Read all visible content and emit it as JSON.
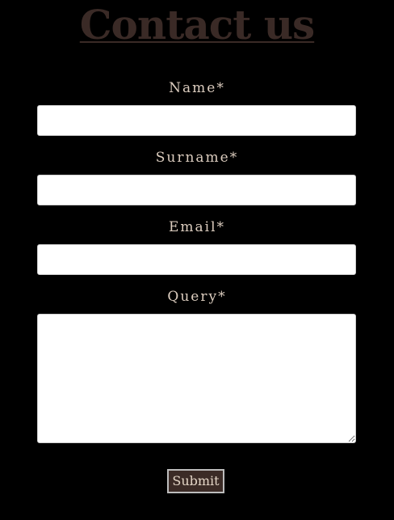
{
  "colors": {
    "background": "#000000",
    "title": "#3a2a26",
    "label": "#dccdbf",
    "button_bg": "#3b2b26",
    "button_text": "#e3d5c6"
  },
  "header": {
    "title": "Contact us"
  },
  "form": {
    "name_label": "Name*",
    "name_value": "",
    "surname_label": "Surname*",
    "surname_value": "",
    "email_label": "Email*",
    "email_value": "",
    "query_label": "Query*",
    "query_value": "",
    "submit_label": "Submit"
  }
}
